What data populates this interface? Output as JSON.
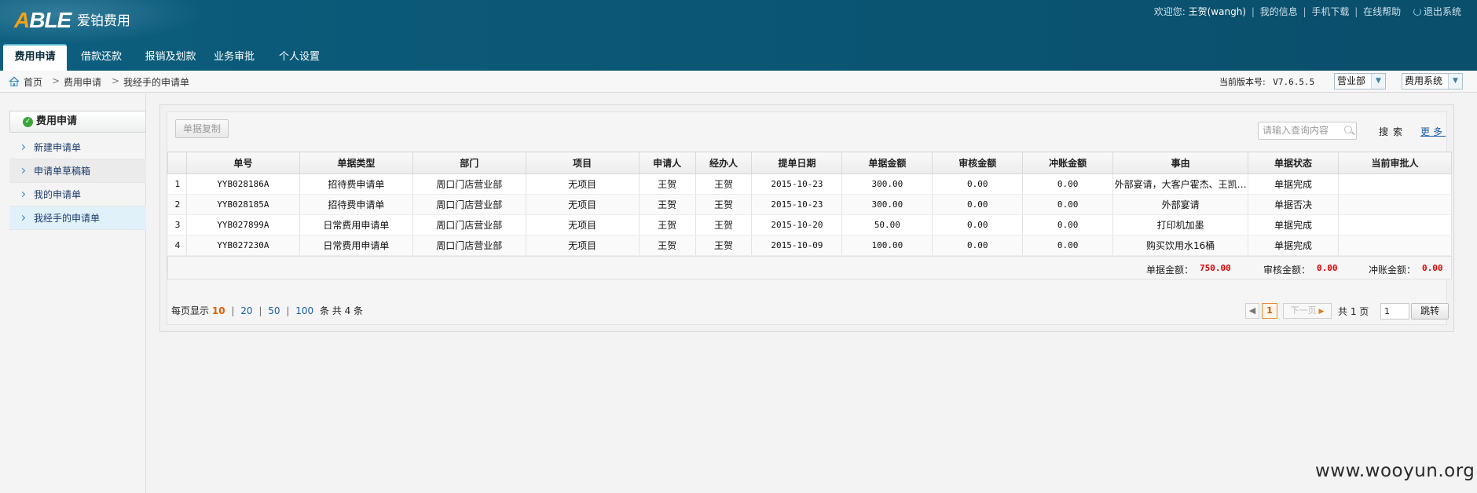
{
  "brand": {
    "logo_text": "ABLE",
    "product_name": "爱铂费用"
  },
  "header": {
    "welcome": "欢迎您:",
    "user": "王贺(wangh)",
    "links": [
      "我的信息",
      "手机下载",
      "在线帮助"
    ],
    "logout": "退出系统",
    "separator": "|"
  },
  "nav": {
    "tabs": [
      {
        "label": "费用申请",
        "active": true
      },
      {
        "label": "借款还款",
        "active": false
      },
      {
        "label": "报销及划款",
        "active": false
      },
      {
        "label": "业务审批",
        "active": false
      },
      {
        "label": "个人设置",
        "active": false
      }
    ]
  },
  "breadcrumb": {
    "items": [
      "首页",
      "费用申请",
      "我经手的申请单"
    ],
    "separator": ">"
  },
  "version": {
    "label": "当前版本号:",
    "value": "V7.6.5.5"
  },
  "selects": {
    "department": "营业部",
    "system": "费用系统"
  },
  "sidebar": {
    "title": "费用申请",
    "items": [
      {
        "label": "新建申请单",
        "active": false
      },
      {
        "label": "申请单草稿箱",
        "active": false
      },
      {
        "label": "我的申请单",
        "active": false
      },
      {
        "label": "我经手的申请单",
        "active": true
      }
    ]
  },
  "toolbar": {
    "copy_button": "单据复制",
    "search_placeholder": "请输入查询内容",
    "search_label": "搜索",
    "more_label": "更多"
  },
  "table": {
    "columns": [
      "",
      "单号",
      "单据类型",
      "部门",
      "项目",
      "申请人",
      "经办人",
      "提单日期",
      "单据金额",
      "审核金额",
      "冲账金额",
      "事由",
      "单据状态",
      "当前审批人"
    ],
    "rows": [
      {
        "idx": "1",
        "no": "YYB028186A",
        "type": "招待费申请单",
        "dept": "周口门店营业部",
        "project": "无项目",
        "applicant": "王贺",
        "handler": "王贺",
        "date": "2015-10-23",
        "amount": "300.00",
        "audit": "0.00",
        "offset": "0.00",
        "reason": "外部宴请，大客户霍杰、王凯…",
        "status": "单据完成",
        "approver": ""
      },
      {
        "idx": "2",
        "no": "YYB028185A",
        "type": "招待费申请单",
        "dept": "周口门店营业部",
        "project": "无项目",
        "applicant": "王贺",
        "handler": "王贺",
        "date": "2015-10-23",
        "amount": "300.00",
        "audit": "0.00",
        "offset": "0.00",
        "reason": "外部宴请",
        "status": "单据否决",
        "approver": ""
      },
      {
        "idx": "3",
        "no": "YYB027899A",
        "type": "日常费用申请单",
        "dept": "周口门店营业部",
        "project": "无项目",
        "applicant": "王贺",
        "handler": "王贺",
        "date": "2015-10-20",
        "amount": "50.00",
        "audit": "0.00",
        "offset": "0.00",
        "reason": "打印机加墨",
        "status": "单据完成",
        "approver": ""
      },
      {
        "idx": "4",
        "no": "YYB027230A",
        "type": "日常费用申请单",
        "dept": "周口门店营业部",
        "project": "无项目",
        "applicant": "王贺",
        "handler": "王贺",
        "date": "2015-10-09",
        "amount": "100.00",
        "audit": "0.00",
        "offset": "0.00",
        "reason": "购买饮用水16桶",
        "status": "单据完成",
        "approver": ""
      }
    ]
  },
  "totals": {
    "amount_label": "单据金额：",
    "amount": "750.00",
    "audit_label": "审核金额：",
    "audit": "0.00",
    "offset_label": "冲账金额：",
    "offset": "0.00"
  },
  "pager": {
    "per_page_label": "每页显示",
    "sizes": [
      "10",
      "20",
      "50",
      "100"
    ],
    "current_size": "10",
    "count_text": "条 共 4 条",
    "current_page": "1",
    "next_label": "下一页",
    "total_pages_text": "共 1 页",
    "goto_value": "1",
    "goto_button": "跳转"
  },
  "watermark": "www.wooyun.org",
  "colors": {
    "header": "#0b5a79",
    "accent_orange": "#f4a21a",
    "total_red": "#e00000",
    "link_blue": "#1a5fa8"
  }
}
